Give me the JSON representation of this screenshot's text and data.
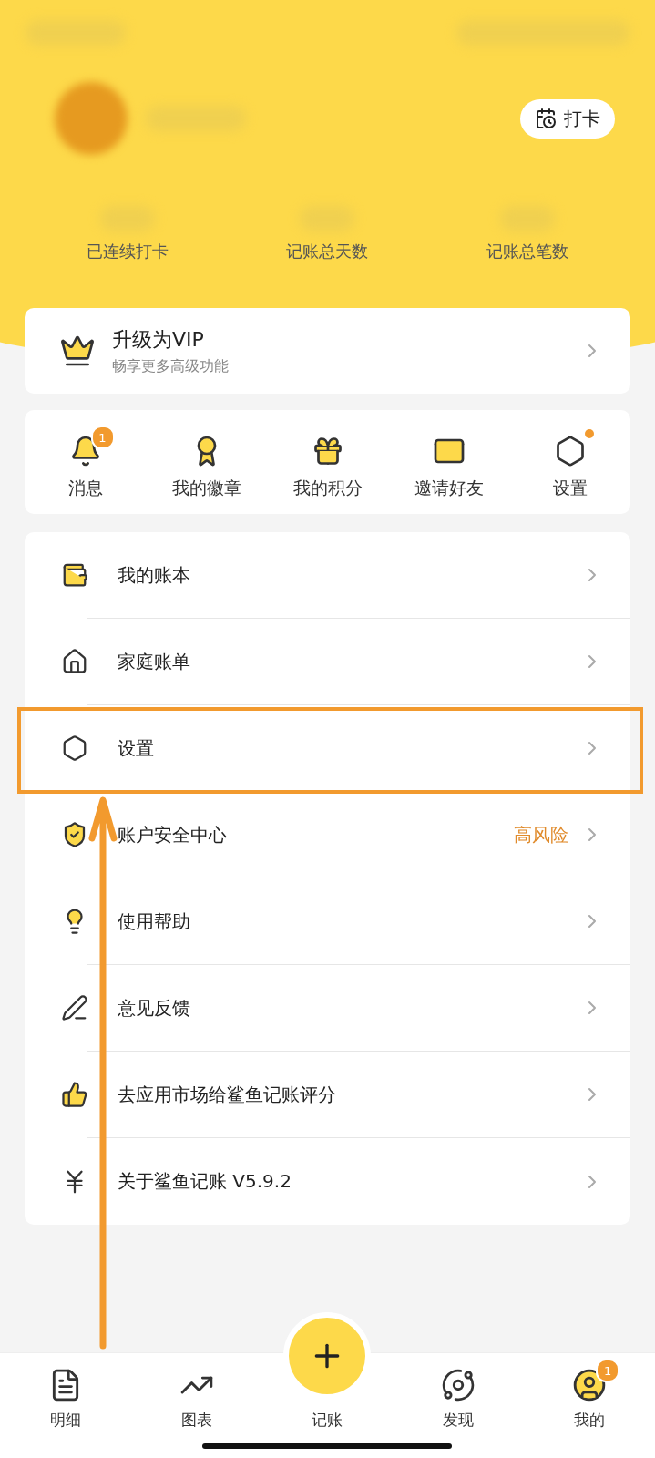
{
  "header": {
    "punch_button": "打卡",
    "stats": [
      {
        "label": "已连续打卡"
      },
      {
        "label": "记账总天数"
      },
      {
        "label": "记账总笔数"
      }
    ]
  },
  "vip": {
    "title": "升级为VIP",
    "subtitle": "畅享更多高级功能"
  },
  "shortcuts": [
    {
      "label": "消息",
      "kind": "bell",
      "badge": "1",
      "dot": false
    },
    {
      "label": "我的徽章",
      "kind": "medal",
      "dot": false
    },
    {
      "label": "我的积分",
      "kind": "gift",
      "dot": false
    },
    {
      "label": "邀请好友",
      "kind": "mail",
      "dot": false
    },
    {
      "label": "设置",
      "kind": "hexagon",
      "dot": true
    }
  ],
  "menu": [
    {
      "label": "我的账本",
      "kind": "wallet",
      "highlighted": false
    },
    {
      "label": "家庭账单",
      "kind": "home",
      "highlighted": false
    },
    {
      "label": "设置",
      "kind": "hexagon",
      "highlighted": true
    },
    {
      "label": "账户安全中心",
      "kind": "shield",
      "note": "高风险",
      "highlighted": false
    },
    {
      "label": "使用帮助",
      "kind": "bulb",
      "highlighted": false
    },
    {
      "label": "意见反馈",
      "kind": "pen",
      "highlighted": false
    },
    {
      "label": "去应用市场给鲨鱼记账评分",
      "kind": "thumb",
      "highlighted": false
    },
    {
      "label": "关于鲨鱼记账 V5.9.2",
      "kind": "yen",
      "highlighted": false
    }
  ],
  "nav": [
    {
      "label": "明细",
      "kind": "list"
    },
    {
      "label": "图表",
      "kind": "chart"
    },
    {
      "label": "记账",
      "kind": "add"
    },
    {
      "label": "发现",
      "kind": "planet"
    },
    {
      "label": "我的",
      "kind": "user",
      "badge": "1"
    }
  ]
}
